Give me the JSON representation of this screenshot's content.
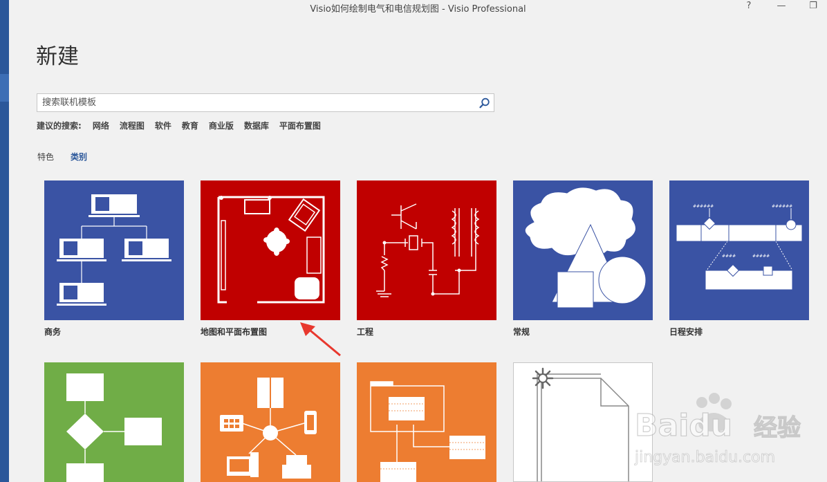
{
  "window": {
    "title": "Visio如何绘制电气和电信规划图 - Visio Professional",
    "help_label": "?",
    "minimize_label": "—",
    "restore_label": "❐"
  },
  "page": {
    "title": "新建"
  },
  "search": {
    "placeholder": "搜索联机模板",
    "value": "",
    "icon": "search-icon"
  },
  "suggestions": {
    "label": "建议的搜索:",
    "items": [
      "网络",
      "流程图",
      "软件",
      "教育",
      "商业版",
      "数据库",
      "平面布置图"
    ]
  },
  "tabs": [
    {
      "label": "特色",
      "active": false
    },
    {
      "label": "类别",
      "active": true
    }
  ],
  "templates": [
    {
      "label": "商务",
      "color": "#3a53a4"
    },
    {
      "label": "地图和平面布置图",
      "color": "#c00000"
    },
    {
      "label": "工程",
      "color": "#c00000"
    },
    {
      "label": "常规",
      "color": "#3a53a4"
    },
    {
      "label": "日程安排",
      "color": "#3a53a4"
    },
    {
      "label": "",
      "color": "#70ad47"
    },
    {
      "label": "",
      "color": "#ed7d31"
    },
    {
      "label": "",
      "color": "#ed7d31"
    },
    {
      "label": "",
      "color": "#ffffff"
    }
  ],
  "schedule_tile_text": {
    "l1": "######",
    "l2": "######",
    "l3": "####",
    "l4": "#####"
  },
  "watermark": {
    "brand": "Baidu",
    "brand_cn": "经验",
    "url": "jingyan.baidu.com"
  }
}
